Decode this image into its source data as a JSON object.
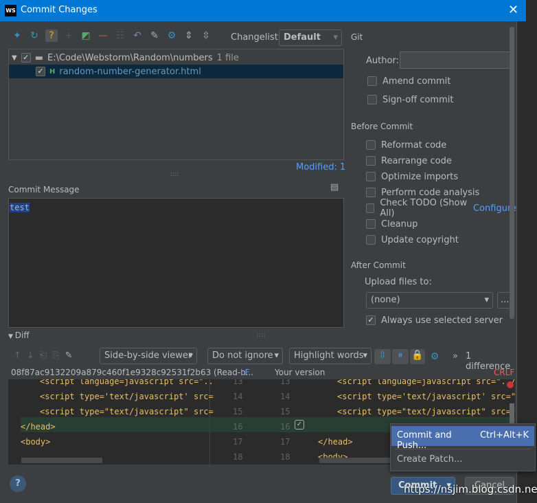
{
  "window": {
    "title": "Commit Changes",
    "app_icon": "WS"
  },
  "toolbar": {
    "changelist_label": "Changelist:",
    "changelist_value": "Default"
  },
  "tree": {
    "root": "E:\\Code\\Webstorm\\Random\\numbers",
    "root_count": "1 file",
    "file": "random-number-generator.html",
    "modified": "Modified: 1"
  },
  "commit_message": {
    "label": "Commit Message",
    "value": "test"
  },
  "git": {
    "title": "Git",
    "author_label": "Author:",
    "author_value": "",
    "amend": "Amend commit",
    "signoff": "Sign-off commit"
  },
  "before_commit": {
    "title": "Before Commit",
    "options": [
      "Reformat code",
      "Rearrange code",
      "Optimize imports",
      "Perform code analysis",
      "Check TODO (Show All)",
      "Cleanup",
      "Update copyright"
    ],
    "configure": "Configure"
  },
  "after_commit": {
    "title": "After Commit",
    "upload_label": "Upload files to:",
    "upload_value": "(none)",
    "browse": "...",
    "always": "Always use selected server"
  },
  "diff": {
    "title": "Diff",
    "viewer": "Side-by-side viewer",
    "ignore": "Do not ignore",
    "highlight": "Highlight words",
    "count": "1 difference",
    "left_title": "08f87ac9132209a879c460f1e9328c92531f2b63 (Read-o...",
    "left_lf": "LF",
    "right_title": "Your version",
    "right_crlf": "CRLF",
    "left_lines": [
      "<script language=javascript src=\"..",
      "<script type='text/javascript' src=",
      "<script type=\"text/javascript\" src=",
      "</head>",
      "<body>",
      ""
    ],
    "right_lines": [
      "<script language=javascript src=\"../",
      "<script type='text/javascript' src=\"",
      "<script type=\"text/javascript\" src=\"",
      "",
      "</head>",
      "<body>"
    ],
    "line_numbers_left": [
      "13",
      "14",
      "15",
      "16",
      "17",
      "18"
    ],
    "line_numbers_right": [
      "13",
      "14",
      "15",
      "16",
      "17",
      "18"
    ]
  },
  "popup": {
    "items": [
      {
        "label": "Commit and Push...",
        "shortcut": "Ctrl+Alt+K"
      },
      {
        "label": "Create Patch..."
      }
    ]
  },
  "buttons": {
    "commit": "Commit",
    "cancel": "Cancel",
    "help": "?"
  },
  "watermark": "https://nsjim.blog.csdn.net"
}
